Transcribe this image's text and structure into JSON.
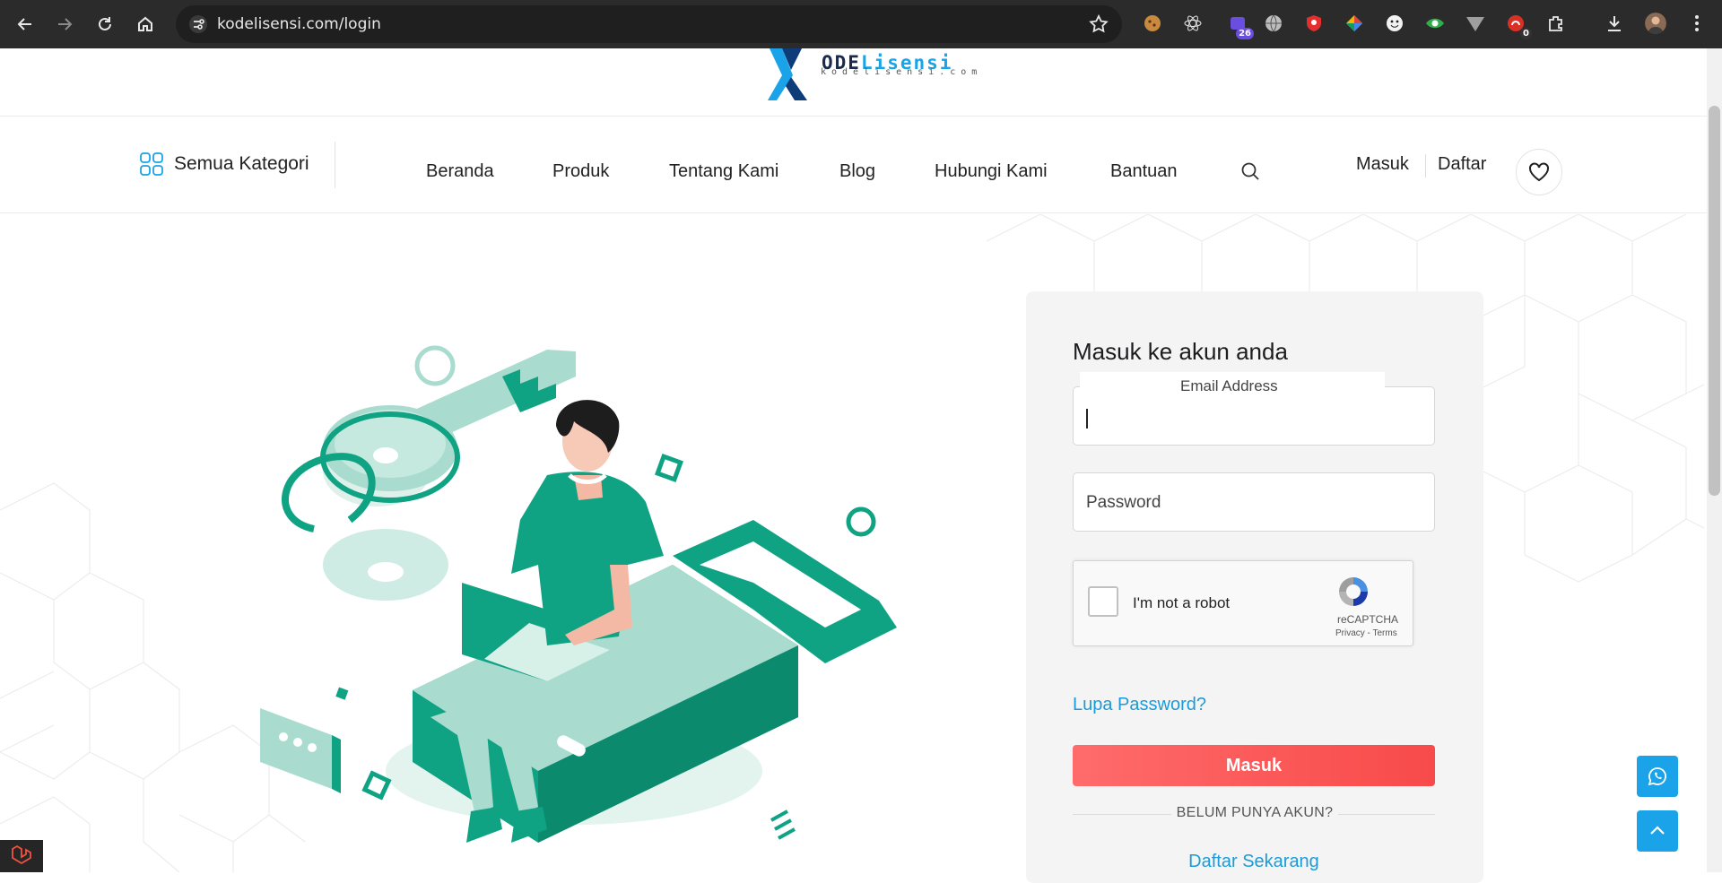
{
  "browser": {
    "url": "kodelisensi.com/login",
    "extension_badges": {
      "tasks": "26",
      "notifications": "0"
    }
  },
  "logo": {
    "title_part1": "ODE",
    "title_part2": "Lisensi",
    "subtitle": "kodelisensi.com"
  },
  "header": {
    "category_button": "Semua Kategori",
    "nav": [
      "Beranda",
      "Produk",
      "Tentang Kami",
      "Blog",
      "Hubungi Kami",
      "Bantuan"
    ],
    "login": "Masuk",
    "register": "Daftar"
  },
  "login_form": {
    "title": "Masuk ke akun anda",
    "email_label": "Email Address",
    "email_value": "",
    "password_placeholder": "Password",
    "captcha_label": "I'm not a robot",
    "captcha_brand": "reCAPTCHA",
    "captcha_terms": "Privacy - Terms",
    "forgot_password": "Lupa Password?",
    "submit": "Masuk",
    "no_account": "BELUM PUNYA AKUN?",
    "register_now": "Daftar Sekarang"
  },
  "colors": {
    "accent_blue": "#1aa3e8",
    "link_blue": "#1b9bd7",
    "submit_red": "#f84a4a",
    "illustration_green": "#0fa383",
    "illustration_mint": "#a9dccf"
  },
  "icons": [
    "back-icon",
    "forward-icon",
    "reload-icon",
    "home-icon",
    "site-info-icon",
    "bookmark-star-icon",
    "extensions-icon",
    "download-icon",
    "profile-avatar-icon",
    "menu-icon",
    "category-grid-icon",
    "search-icon",
    "heart-icon",
    "whatsapp-icon",
    "arrow-up-icon",
    "laravel-icon"
  ]
}
